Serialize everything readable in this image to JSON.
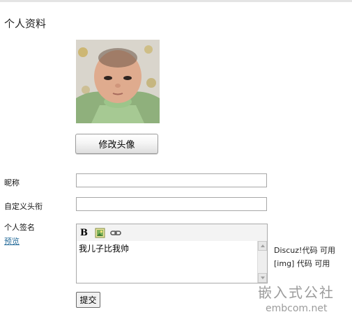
{
  "page": {
    "title": "个人资料"
  },
  "avatar": {
    "change_button": "修改头像"
  },
  "fields": {
    "nickname": {
      "label": "昵称",
      "value": ""
    },
    "custom_title": {
      "label": "自定义头衔",
      "value": ""
    },
    "signature": {
      "label": "个人签名",
      "preview_link": "预览",
      "value": "我儿子比我帅",
      "toolbar": [
        "bold-icon",
        "insert-image-icon",
        "insert-link-icon"
      ],
      "help": {
        "discuz_code": "Discuz!代码  可用",
        "img_code": "[img] 代码  可用"
      }
    }
  },
  "form": {
    "submit_label": "提交"
  },
  "watermark": {
    "main": "嵌入式公社",
    "site": "embcom.net"
  }
}
